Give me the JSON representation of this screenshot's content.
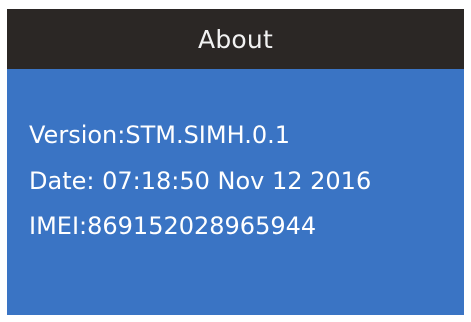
{
  "colors": {
    "title_bar_bg": "#2b2725",
    "screen_bg": "#3a74c4",
    "text": "#ffffff"
  },
  "header": {
    "title": "About"
  },
  "about": {
    "version": "Version:STM.SIMH.0.1",
    "date": "Date: 07:18:50 Nov 12 2016",
    "imei": "IMEI:869152028965944"
  }
}
